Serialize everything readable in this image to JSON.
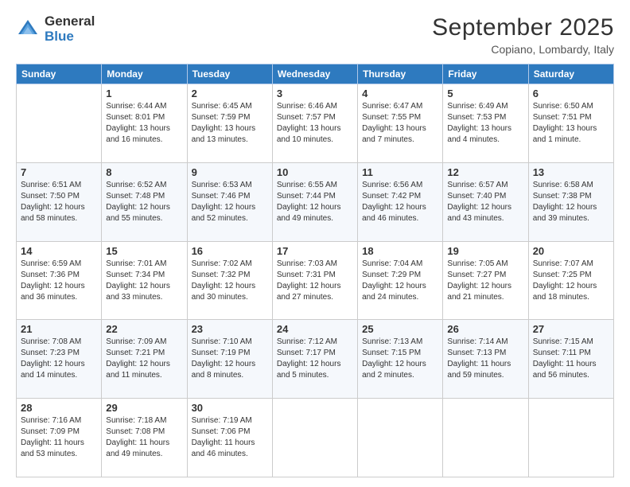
{
  "logo": {
    "general": "General",
    "blue": "Blue"
  },
  "header": {
    "month": "September 2025",
    "location": "Copiano, Lombardy, Italy"
  },
  "days_of_week": [
    "Sunday",
    "Monday",
    "Tuesday",
    "Wednesday",
    "Thursday",
    "Friday",
    "Saturday"
  ],
  "weeks": [
    [
      {
        "day": "",
        "sunrise": "",
        "sunset": "",
        "daylight": ""
      },
      {
        "day": "1",
        "sunrise": "Sunrise: 6:44 AM",
        "sunset": "Sunset: 8:01 PM",
        "daylight": "Daylight: 13 hours and 16 minutes."
      },
      {
        "day": "2",
        "sunrise": "Sunrise: 6:45 AM",
        "sunset": "Sunset: 7:59 PM",
        "daylight": "Daylight: 13 hours and 13 minutes."
      },
      {
        "day": "3",
        "sunrise": "Sunrise: 6:46 AM",
        "sunset": "Sunset: 7:57 PM",
        "daylight": "Daylight: 13 hours and 10 minutes."
      },
      {
        "day": "4",
        "sunrise": "Sunrise: 6:47 AM",
        "sunset": "Sunset: 7:55 PM",
        "daylight": "Daylight: 13 hours and 7 minutes."
      },
      {
        "day": "5",
        "sunrise": "Sunrise: 6:49 AM",
        "sunset": "Sunset: 7:53 PM",
        "daylight": "Daylight: 13 hours and 4 minutes."
      },
      {
        "day": "6",
        "sunrise": "Sunrise: 6:50 AM",
        "sunset": "Sunset: 7:51 PM",
        "daylight": "Daylight: 13 hours and 1 minute."
      }
    ],
    [
      {
        "day": "7",
        "sunrise": "Sunrise: 6:51 AM",
        "sunset": "Sunset: 7:50 PM",
        "daylight": "Daylight: 12 hours and 58 minutes."
      },
      {
        "day": "8",
        "sunrise": "Sunrise: 6:52 AM",
        "sunset": "Sunset: 7:48 PM",
        "daylight": "Daylight: 12 hours and 55 minutes."
      },
      {
        "day": "9",
        "sunrise": "Sunrise: 6:53 AM",
        "sunset": "Sunset: 7:46 PM",
        "daylight": "Daylight: 12 hours and 52 minutes."
      },
      {
        "day": "10",
        "sunrise": "Sunrise: 6:55 AM",
        "sunset": "Sunset: 7:44 PM",
        "daylight": "Daylight: 12 hours and 49 minutes."
      },
      {
        "day": "11",
        "sunrise": "Sunrise: 6:56 AM",
        "sunset": "Sunset: 7:42 PM",
        "daylight": "Daylight: 12 hours and 46 minutes."
      },
      {
        "day": "12",
        "sunrise": "Sunrise: 6:57 AM",
        "sunset": "Sunset: 7:40 PM",
        "daylight": "Daylight: 12 hours and 43 minutes."
      },
      {
        "day": "13",
        "sunrise": "Sunrise: 6:58 AM",
        "sunset": "Sunset: 7:38 PM",
        "daylight": "Daylight: 12 hours and 39 minutes."
      }
    ],
    [
      {
        "day": "14",
        "sunrise": "Sunrise: 6:59 AM",
        "sunset": "Sunset: 7:36 PM",
        "daylight": "Daylight: 12 hours and 36 minutes."
      },
      {
        "day": "15",
        "sunrise": "Sunrise: 7:01 AM",
        "sunset": "Sunset: 7:34 PM",
        "daylight": "Daylight: 12 hours and 33 minutes."
      },
      {
        "day": "16",
        "sunrise": "Sunrise: 7:02 AM",
        "sunset": "Sunset: 7:32 PM",
        "daylight": "Daylight: 12 hours and 30 minutes."
      },
      {
        "day": "17",
        "sunrise": "Sunrise: 7:03 AM",
        "sunset": "Sunset: 7:31 PM",
        "daylight": "Daylight: 12 hours and 27 minutes."
      },
      {
        "day": "18",
        "sunrise": "Sunrise: 7:04 AM",
        "sunset": "Sunset: 7:29 PM",
        "daylight": "Daylight: 12 hours and 24 minutes."
      },
      {
        "day": "19",
        "sunrise": "Sunrise: 7:05 AM",
        "sunset": "Sunset: 7:27 PM",
        "daylight": "Daylight: 12 hours and 21 minutes."
      },
      {
        "day": "20",
        "sunrise": "Sunrise: 7:07 AM",
        "sunset": "Sunset: 7:25 PM",
        "daylight": "Daylight: 12 hours and 18 minutes."
      }
    ],
    [
      {
        "day": "21",
        "sunrise": "Sunrise: 7:08 AM",
        "sunset": "Sunset: 7:23 PM",
        "daylight": "Daylight: 12 hours and 14 minutes."
      },
      {
        "day": "22",
        "sunrise": "Sunrise: 7:09 AM",
        "sunset": "Sunset: 7:21 PM",
        "daylight": "Daylight: 12 hours and 11 minutes."
      },
      {
        "day": "23",
        "sunrise": "Sunrise: 7:10 AM",
        "sunset": "Sunset: 7:19 PM",
        "daylight": "Daylight: 12 hours and 8 minutes."
      },
      {
        "day": "24",
        "sunrise": "Sunrise: 7:12 AM",
        "sunset": "Sunset: 7:17 PM",
        "daylight": "Daylight: 12 hours and 5 minutes."
      },
      {
        "day": "25",
        "sunrise": "Sunrise: 7:13 AM",
        "sunset": "Sunset: 7:15 PM",
        "daylight": "Daylight: 12 hours and 2 minutes."
      },
      {
        "day": "26",
        "sunrise": "Sunrise: 7:14 AM",
        "sunset": "Sunset: 7:13 PM",
        "daylight": "Daylight: 11 hours and 59 minutes."
      },
      {
        "day": "27",
        "sunrise": "Sunrise: 7:15 AM",
        "sunset": "Sunset: 7:11 PM",
        "daylight": "Daylight: 11 hours and 56 minutes."
      }
    ],
    [
      {
        "day": "28",
        "sunrise": "Sunrise: 7:16 AM",
        "sunset": "Sunset: 7:09 PM",
        "daylight": "Daylight: 11 hours and 53 minutes."
      },
      {
        "day": "29",
        "sunrise": "Sunrise: 7:18 AM",
        "sunset": "Sunset: 7:08 PM",
        "daylight": "Daylight: 11 hours and 49 minutes."
      },
      {
        "day": "30",
        "sunrise": "Sunrise: 7:19 AM",
        "sunset": "Sunset: 7:06 PM",
        "daylight": "Daylight: 11 hours and 46 minutes."
      },
      {
        "day": "",
        "sunrise": "",
        "sunset": "",
        "daylight": ""
      },
      {
        "day": "",
        "sunrise": "",
        "sunset": "",
        "daylight": ""
      },
      {
        "day": "",
        "sunrise": "",
        "sunset": "",
        "daylight": ""
      },
      {
        "day": "",
        "sunrise": "",
        "sunset": "",
        "daylight": ""
      }
    ]
  ]
}
